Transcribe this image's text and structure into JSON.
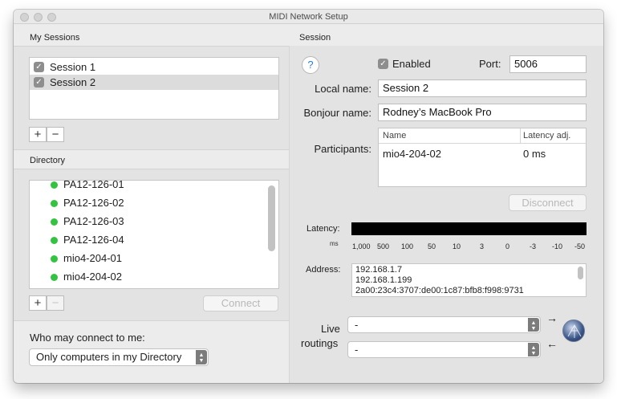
{
  "window": {
    "title": "MIDI Network Setup"
  },
  "my_sessions": {
    "label": "My Sessions",
    "sessions": [
      {
        "name": "Session 1",
        "checked": true,
        "selected": false
      },
      {
        "name": "Session 2",
        "checked": true,
        "selected": true
      }
    ],
    "add_label": "+",
    "remove_label": "−"
  },
  "directory": {
    "label": "Directory",
    "items": [
      "PA12-126-01",
      "PA12-126-02",
      "PA12-126-03",
      "PA12-126-04",
      "mio4-204-01",
      "mio4-204-02"
    ],
    "add_label": "+",
    "remove_label": "−",
    "connect_label": "Connect"
  },
  "who_may_connect": {
    "label": "Who may connect to me:",
    "selected": "Only computers in my Directory"
  },
  "session": {
    "label": "Session",
    "help_label": "?",
    "enabled_label": "Enabled",
    "enabled": true,
    "port_label": "Port:",
    "port": "5006",
    "local_name_label": "Local name:",
    "local_name": "Session 2",
    "bonjour_name_label": "Bonjour name:",
    "bonjour_name": "Rodney’s MacBook Pro",
    "participants_label": "Participants:",
    "participants_columns": [
      "Name",
      "Latency adj."
    ],
    "participants": [
      {
        "name": "mio4-204-02",
        "latency": "0 ms"
      }
    ],
    "disconnect_label": "Disconnect",
    "latency_label": "Latency:",
    "latency_unit": "ms",
    "latency_ticks": [
      "1,000",
      "500",
      "100",
      "50",
      "10",
      "3",
      "0",
      "-3",
      "-10",
      "-50"
    ],
    "address_label": "Address:",
    "addresses": [
      "192.168.1.7",
      "192.168.1.199",
      "2a00:23c4:3707:de00:1c87:bfb8:f998:9731"
    ],
    "live_routings_label_1": "Live",
    "live_routings_label_2": "routings",
    "routing_in": "-",
    "routing_out": "-"
  },
  "colors": {
    "online_dot": "#33c341",
    "latency_bar": "#000000",
    "selected_row": "#dcdcdc"
  }
}
